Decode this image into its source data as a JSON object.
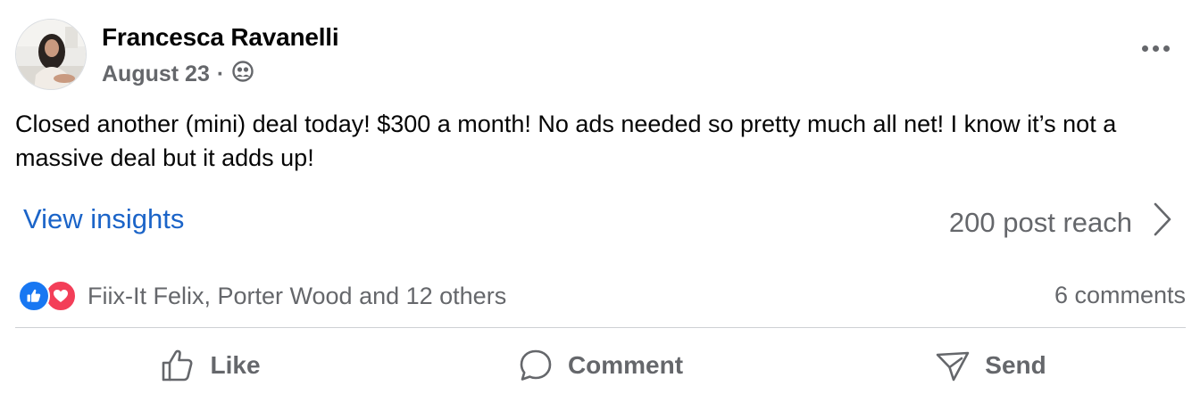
{
  "post": {
    "author": "Francesca Ravanelli",
    "date": "August 23",
    "separator": "·",
    "audience_icon": "friends-icon",
    "text": "Closed another (mini) deal today! $300 a month! No ads needed so pretty much all net! I know it’s not a massive deal but it adds up!",
    "insights_label": "View insights",
    "reach_label": "200 post reach",
    "reactors": "Fiix-It Felix, Porter Wood and 12 others",
    "comments_count": "6 comments"
  },
  "actions": {
    "like": "Like",
    "comment": "Comment",
    "send": "Send"
  },
  "colors": {
    "link": "#1b64c8",
    "secondary_text": "#65676b",
    "like_reaction": "#1877f2",
    "love_reaction": "#f33e58",
    "divider": "#ced0d4"
  }
}
